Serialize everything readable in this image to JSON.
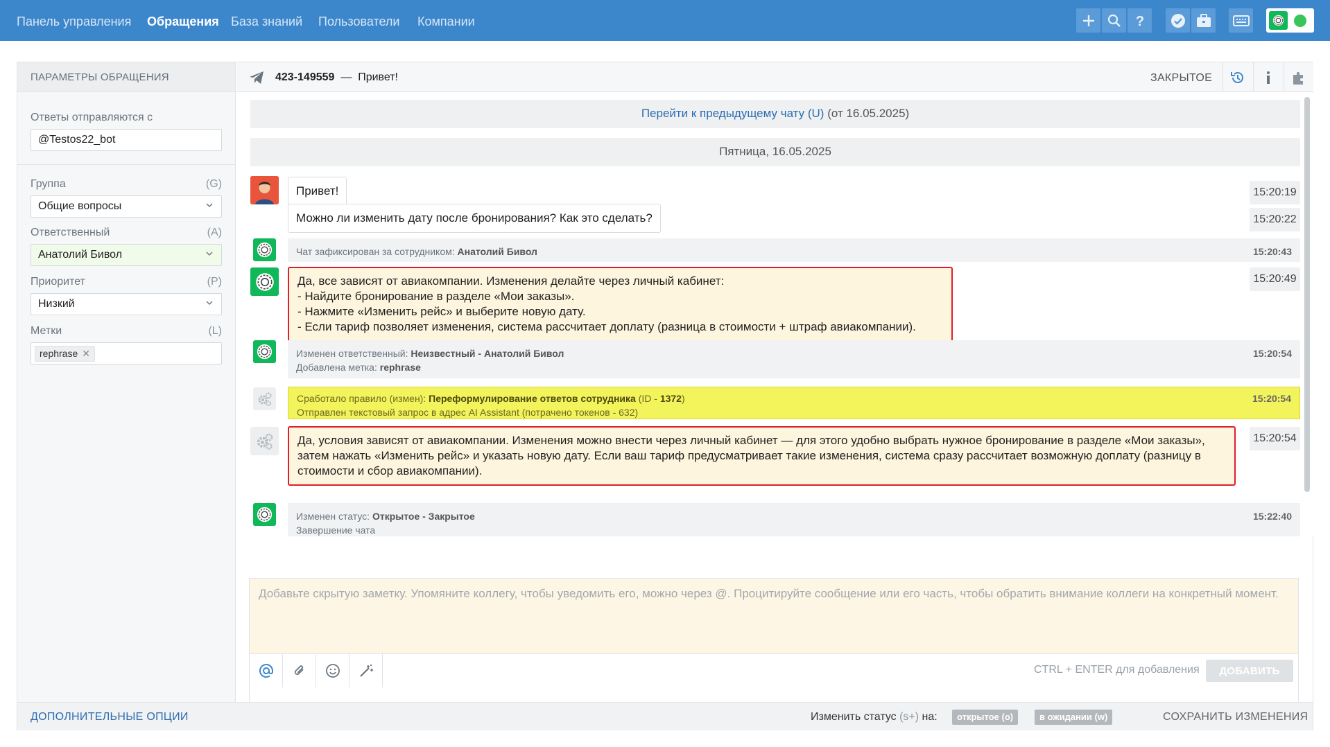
{
  "nav": {
    "items": [
      "Панель управления",
      "Обращения",
      "База знаний",
      "Пользователи",
      "Компании"
    ],
    "active_index": 1,
    "icons": [
      "plus-icon",
      "search-icon",
      "help-icon",
      "check-icon",
      "briefcase-icon",
      "keyboard-icon"
    ]
  },
  "sidebar": {
    "title": "ПАРАМЕТРЫ ОБРАЩЕНИЯ",
    "sender_label": "Ответы отправляются с",
    "sender_value": "@Testos22_bot",
    "group_label": "Группа",
    "group_hotkey": "(G)",
    "group_value": "Общие вопросы",
    "assignee_label": "Ответственный",
    "assignee_hotkey": "(A)",
    "assignee_value": "Анатолий Бивол",
    "priority_label": "Приоритет",
    "priority_hotkey": "(P)",
    "priority_value": "Низкий",
    "tags_label": "Метки",
    "tags_hotkey": "(L)",
    "tags": [
      "rephrase"
    ]
  },
  "header": {
    "ticket_id": "423-149559",
    "dash": "—",
    "subject": "Привет!",
    "status": "ЗАКРЫТОЕ"
  },
  "feed": {
    "prev_chat_link": "Перейти к предыдущему чату (U)",
    "prev_chat_date": "(от 16.05.2025)",
    "date_divider": "Пятница, 16.05.2025",
    "msg1": {
      "text": "Привет!",
      "time": "15:20:19"
    },
    "msg2": {
      "text": "Можно ли изменить дату после бронирования? Как это сделать?",
      "time": "15:20:22"
    },
    "sys1": {
      "prefix": "Чат зафиксирован за сотрудником:",
      "bold": "Анатолий Бивол",
      "time": "15:20:43"
    },
    "op1": {
      "lines": [
        "Да, все зависят от авиакомпании. Изменения делайте через личный кабинет:",
        "- Найдите бронирование в разделе «Мои заказы».",
        "- Нажмите «Изменить рейс» и выберите новую дату.",
        "- Если тариф позволяет изменения, система рассчитает доплату (разница в стоимости + штраф авиакомпании)."
      ],
      "time": "15:20:49"
    },
    "sys2": {
      "l1_prefix": "Изменен ответственный:",
      "l1_bold": "Неизвестный - Анатолий Бивол",
      "l2_prefix": "Добавлена метка:",
      "l2_bold": "rephrase",
      "time": "15:20:54"
    },
    "rule": {
      "l1_prefix": "Сработало правило (измен):",
      "l1_bold": "Переформулирование ответов сотрудника",
      "l1_id_prefix": "(ID -",
      "l1_id": "1372",
      "l1_id_suffix": ")",
      "l2": "Отправлен текстовый запрос в адрес AI Assistant (потрачено токенов - 632)",
      "time": "15:20:54"
    },
    "op2": {
      "text": "Да, условия зависят от авиакомпании. Изменения можно внести через личный кабинет — для этого удобно выбрать нужное бронирование в разделе «Мои заказы», затем нажать «Изменить рейс» и указать новую дату. Если ваш тариф предусматривает такие изменения, система сразу рассчитает возможную доплату (разницу в стоимости и сбор авиакомпании).",
      "time": "15:20:54"
    },
    "sys3": {
      "l1_prefix": "Изменен статус:",
      "l1_bold": "Открытое - Закрытое",
      "l2": "Завершение чата",
      "time": "15:22:40"
    }
  },
  "note": {
    "placeholder": "Добавьте скрытую заметку. Упомяните коллегу, чтобы уведомить его, можно через @. Процитируйте сообщение или его часть, чтобы обратить внимание коллеги на конкретный момент.",
    "hint": "CTRL + ENTER для добавления",
    "add_label": "ДОБАВИТЬ"
  },
  "footer": {
    "more_options": "ДОПОЛНИТЕЛЬНЫЕ ОПЦИИ",
    "change_status_label": "Изменить статус",
    "change_status_hotkey": "(s+)",
    "change_status_suffix": "на:",
    "status_open": "открытое (o)",
    "status_waiting": "в ожидании (w)",
    "save": "СОХРАНИТЬ ИЗМЕНЕНИЯ"
  },
  "colors": {
    "nav_bg": "#3c87cc",
    "bot_green": "#10b85a",
    "highlight_red": "#e11d2b",
    "rule_yellow": "#f3f35c",
    "link_blue": "#2b6cb0"
  }
}
